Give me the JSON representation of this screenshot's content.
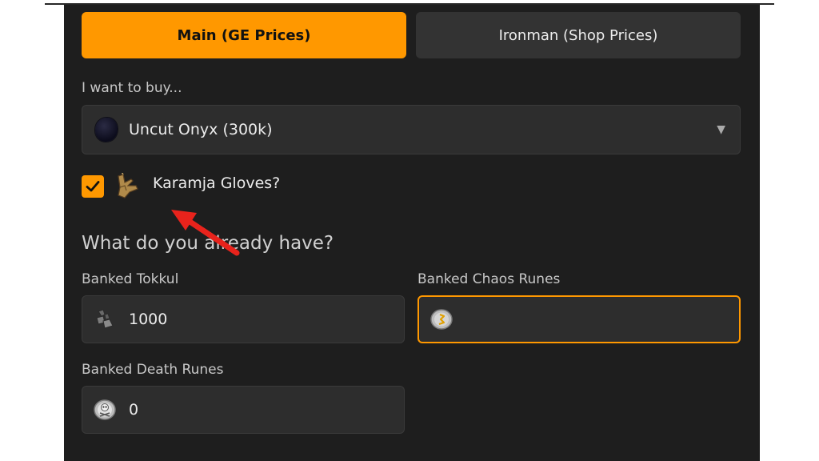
{
  "tabs": {
    "main_label": "Main (GE Prices)",
    "ironman_label": "Ironman (Shop Prices)"
  },
  "buy": {
    "label": "I want to buy...",
    "selected": "Uncut Onyx (300k)"
  },
  "gloves": {
    "label": "Karamja Gloves?",
    "checked": true
  },
  "have": {
    "title": "What do you already have?",
    "tokkul_label": "Banked Tokkul",
    "tokkul_value": "1000",
    "chaos_label": "Banked Chaos Runes",
    "chaos_value": "",
    "death_label": "Banked Death Runes",
    "death_value": "0"
  },
  "colors": {
    "accent": "#ff9800",
    "panel_bg": "#1e1e1e",
    "field_bg": "#2d2d2d",
    "annotation_arrow": "#e8231c"
  }
}
